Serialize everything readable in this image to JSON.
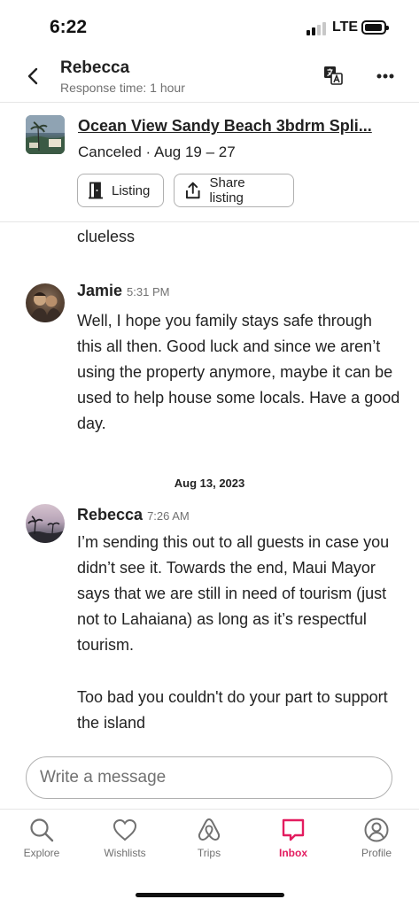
{
  "status_bar": {
    "time": "6:22",
    "network": "LTE"
  },
  "header": {
    "name": "Rebecca",
    "subtitle": "Response time: 1 hour"
  },
  "listing": {
    "title": "Ocean View Sandy Beach 3bdrm Spli...",
    "status": "Canceled · Aug 19 – 27",
    "buttons": {
      "listing_label": "Listing",
      "share_label": "Share listing"
    }
  },
  "messages": {
    "previous_tail": {
      "text": "family during this difficult time. You are totally clueless"
    },
    "jamie": {
      "sender": "Jamie",
      "time": "5:31 PM",
      "text": "Well, I hope you family stays safe through this all then. Good luck and since we aren’t using the property anymore, maybe it can be used to help house some locals. Have a good day."
    },
    "date_separator": "Aug 13, 2023",
    "rebecca": {
      "sender": "Rebecca",
      "time": "7:26 AM",
      "text_p1": "I’m sending this out to all guests in case you didn’t see it. Towards the end, Maui Mayor says that we are still in need of tourism (just not to Lahaiana) as long as it’s respectful tourism.",
      "text_p2": "Too bad you couldn't do your part to support the island"
    }
  },
  "composer": {
    "placeholder": "Write a message"
  },
  "tabs": [
    {
      "label": "Explore",
      "icon": "search-icon",
      "active": false
    },
    {
      "label": "Wishlists",
      "icon": "heart-icon",
      "active": false
    },
    {
      "label": "Trips",
      "icon": "airbnb-logo-icon",
      "active": false
    },
    {
      "label": "Inbox",
      "icon": "chat-bubble-icon",
      "active": true
    },
    {
      "label": "Profile",
      "icon": "profile-icon",
      "active": false
    }
  ],
  "colors": {
    "accent": "#E31C5F",
    "text": "#222222",
    "secondary_text": "#717171",
    "border": "#B0B0B0"
  }
}
